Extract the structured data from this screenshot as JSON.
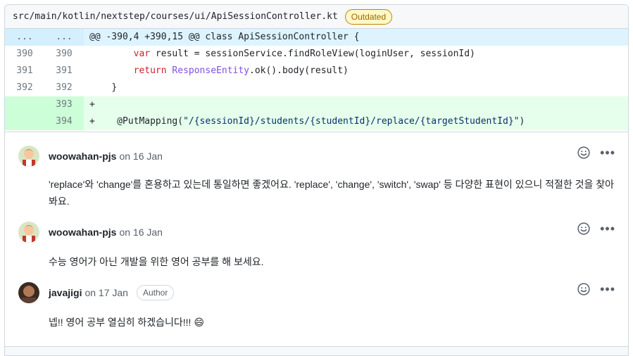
{
  "file": {
    "path": "src/main/kotlin/nextstep/courses/ui/ApiSessionController.kt",
    "status_badge": "Outdated"
  },
  "diff": {
    "hunk": {
      "left": "...",
      "right": "...",
      "text": "@@ -390,4 +390,15 @@ class ApiSessionController {"
    },
    "lines": [
      {
        "left": "390",
        "right": "390",
        "type": "context"
      },
      {
        "left": "391",
        "right": "391",
        "type": "context"
      },
      {
        "left": "392",
        "right": "392",
        "type": "context"
      },
      {
        "left": "",
        "right": "393",
        "type": "add"
      },
      {
        "left": "",
        "right": "394",
        "type": "add"
      }
    ],
    "code": {
      "l390_kw": "var",
      "l390_rest": " result = sessionService.findRoleView(loginUser, sessionId)",
      "l391_kw": "return",
      "l391_type": "ResponseEntity",
      "l391_rest": ".ok().body(result)",
      "l392": "}",
      "l393": "+",
      "l394_prefix": "+",
      "l394_ann": "@PutMapping(",
      "l394_str": "\"/{sessionId}/students/{studentId}/replace/{targetStudentId}\"",
      "l394_end": ")"
    }
  },
  "comments": [
    {
      "author": "woowahan-pjs",
      "date": "on 16 Jan",
      "text": "'replace'와 'change'를 혼용하고 있는데 통일하면 좋겠어요. 'replace', 'change', 'switch', 'swap' 등 다양한 표현이 있으니 적절한 것을 찾아봐요."
    },
    {
      "author": "woowahan-pjs",
      "date": "on 16 Jan",
      "text": "수능 영어가 아닌 개발을 위한 영어 공부를 해 보세요."
    },
    {
      "author": "javajigi",
      "date": "on 17 Jan",
      "badge": "Author",
      "text": "넵!! 영어 공부 열심히 하겠습니다!!! 😄"
    }
  ],
  "icons": {
    "reaction": "smiley-icon",
    "menu": "kebab-horizontal-icon"
  },
  "colors": {
    "add_bg": "#e6ffec",
    "add_num_bg": "#ccffd8",
    "hunk_bg": "#ddf4ff",
    "outdated_border": "#bf8700"
  }
}
